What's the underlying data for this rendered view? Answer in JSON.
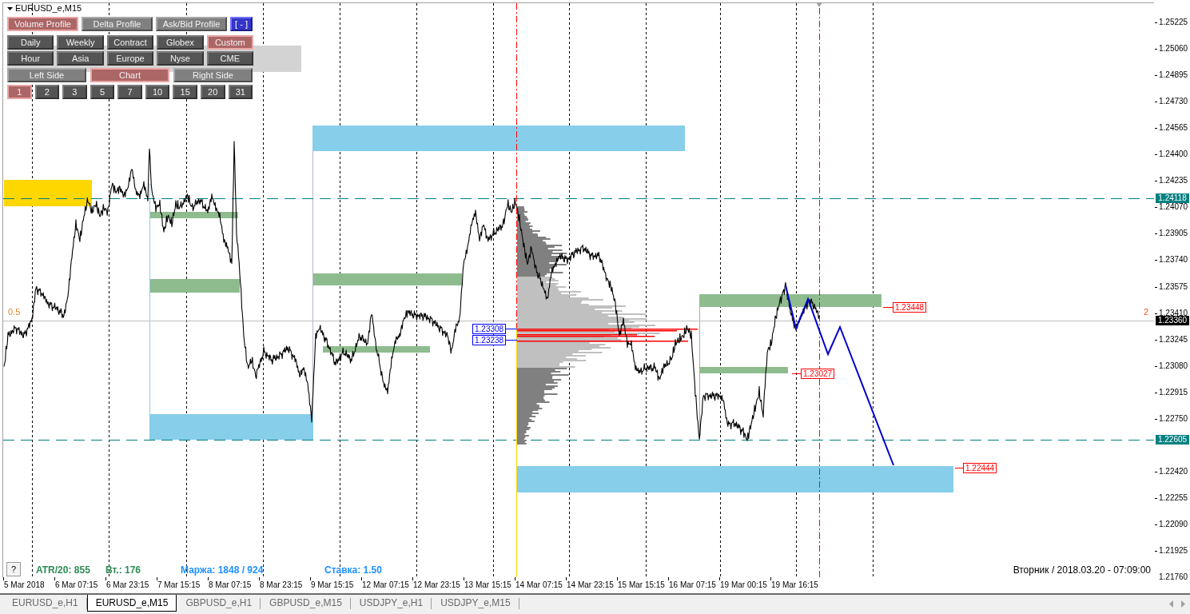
{
  "chart": {
    "title": "EURUSD_e,M15",
    "profile_buttons": [
      {
        "label": "Volume Profile",
        "selected": true
      },
      {
        "label": "Delta Profile",
        "selected": false
      },
      {
        "label": "Ask/Bid Profile",
        "selected": false
      }
    ],
    "collapse_button": "[ - ]",
    "session_rows": [
      {
        "buttons": [
          {
            "label": "Daily",
            "selected": false
          },
          {
            "label": "Weekly",
            "selected": false
          },
          {
            "label": "Contract",
            "selected": false
          },
          {
            "label": "Globex",
            "selected": false
          },
          {
            "label": "Custom",
            "selected": true
          }
        ]
      },
      {
        "buttons": [
          {
            "label": "Hour",
            "selected": false
          },
          {
            "label": "Asia",
            "selected": false
          },
          {
            "label": "Europe",
            "selected": false
          },
          {
            "label": "Nyse",
            "selected": false
          },
          {
            "label": "CME",
            "selected": false
          }
        ]
      }
    ],
    "side_buttons": [
      {
        "label": "Left Side",
        "selected": false
      },
      {
        "label": "Chart",
        "selected": true
      },
      {
        "label": "Right Side",
        "selected": false
      }
    ],
    "day_buttons": [
      {
        "label": "1",
        "selected": true
      },
      {
        "label": "2",
        "selected": false
      },
      {
        "label": "3",
        "selected": false
      },
      {
        "label": "5",
        "selected": false
      },
      {
        "label": "7",
        "selected": false
      },
      {
        "label": "10",
        "selected": false
      },
      {
        "label": "15",
        "selected": false
      },
      {
        "label": "20",
        "selected": false
      },
      {
        "label": "31",
        "selected": false
      }
    ],
    "left_marker": "0.5",
    "right_marker": "2",
    "profile_labels": [
      "1.23308",
      "1.23238"
    ],
    "level_labels": [
      "1.23448",
      "1.23027",
      "1.22444"
    ],
    "help_button": "?",
    "indicators": [
      {
        "text": "ATR/20: 855",
        "color": "#2e8b57"
      },
      {
        "text": "Вт.: 176",
        "color": "#2e8b57"
      },
      {
        "text": "Маржа: 1848 / 924",
        "color": "#1e90ff"
      },
      {
        "text": "Ставка: 1.50",
        "color": "#1e90ff"
      }
    ],
    "server_time": "Вторник / 2018.03.20 - 07:09:00"
  },
  "price_axis": {
    "ticks": [
      "1.25225",
      "1.25060",
      "1.24895",
      "1.24730",
      "1.24565",
      "1.24400",
      "1.24235",
      "1.24070",
      "1.23905",
      "1.23740",
      "1.23575",
      "1.23410",
      "1.23245",
      "1.23080",
      "1.22915",
      "1.22750",
      "1.22420",
      "1.22255",
      "1.22090",
      "1.21925",
      "1.21760"
    ],
    "badges": [
      {
        "text": "1.24118",
        "color": "#008080"
      },
      {
        "text": "1.23360",
        "color": "#000000"
      },
      {
        "text": "1.22605",
        "color": "#008080"
      }
    ]
  },
  "time_axis": {
    "labels": [
      "5 Mar 2018",
      "6 Mar 07:15",
      "6 Mar 23:15",
      "7 Mar 15:15",
      "8 Mar 07:15",
      "8 Mar 23:15",
      "9 Mar 15:15",
      "12 Mar 07:15",
      "12 Mar 23:15",
      "13 Mar 15:15",
      "14 Mar 07:15",
      "14 Mar 23:15",
      "15 Mar 15:15",
      "16 Mar 07:15",
      "19 Mar 00:15",
      "19 Mar 16:15"
    ]
  },
  "tabs": [
    {
      "label": "EURUSD_e,H1",
      "selected": false
    },
    {
      "label": "EURUSD_e,M15",
      "selected": true
    },
    {
      "label": "GBPUSD_e,H1",
      "selected": false
    },
    {
      "label": "GBPUSD_e,M15",
      "selected": false
    },
    {
      "label": "USDJPY_e,H1",
      "selected": false
    },
    {
      "label": "USDJPY_e,M15",
      "selected": false
    }
  ]
}
